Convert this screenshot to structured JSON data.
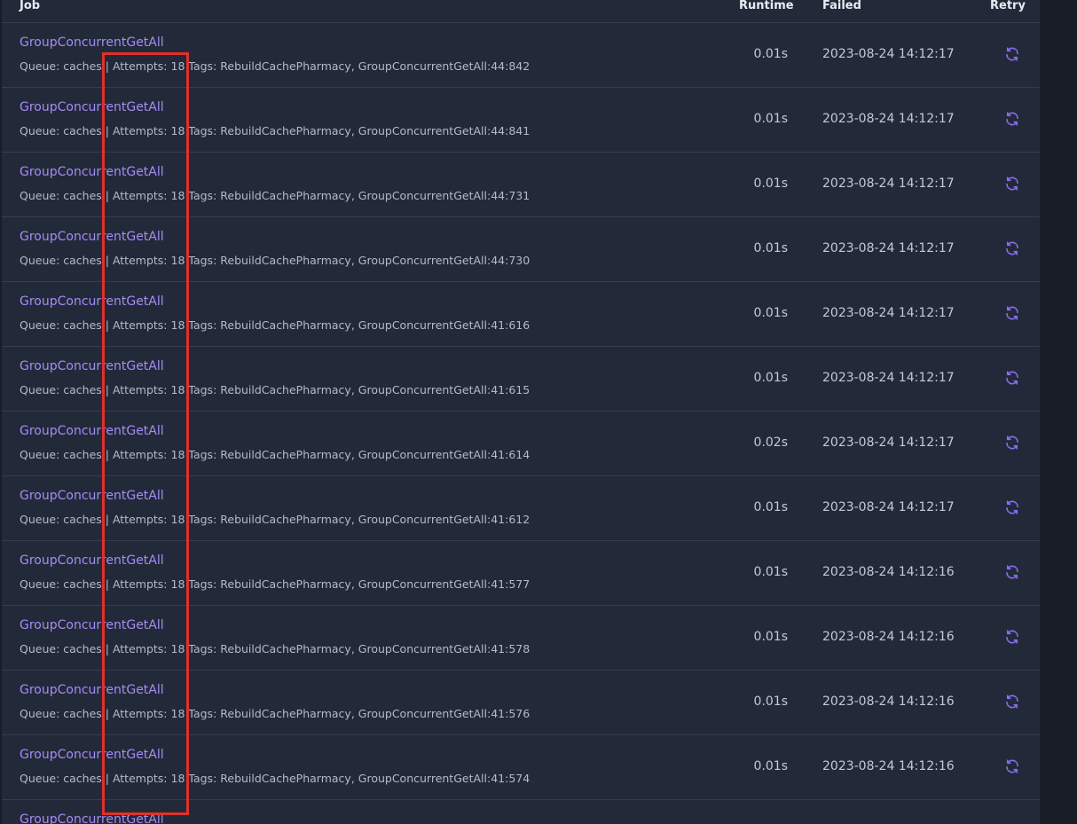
{
  "header": {
    "job": "Job",
    "runtime": "Runtime",
    "failed": "Failed",
    "retry": "Retry"
  },
  "jobs": [
    {
      "name": "GroupConcurrentGetAll",
      "queue": "Queue: caches",
      "attempts": "Attempts: 18",
      "tags": "Tags: RebuildCachePharmacy, GroupConcurrentGetAll:44:842",
      "runtime": "0.01s",
      "failed": "2023-08-24 14:12:17"
    },
    {
      "name": "GroupConcurrentGetAll",
      "queue": "Queue: caches",
      "attempts": "Attempts: 18",
      "tags": "Tags: RebuildCachePharmacy, GroupConcurrentGetAll:44:841",
      "runtime": "0.01s",
      "failed": "2023-08-24 14:12:17"
    },
    {
      "name": "GroupConcurrentGetAll",
      "queue": "Queue: caches",
      "attempts": "Attempts: 18",
      "tags": "Tags: RebuildCachePharmacy, GroupConcurrentGetAll:44:731",
      "runtime": "0.01s",
      "failed": "2023-08-24 14:12:17"
    },
    {
      "name": "GroupConcurrentGetAll",
      "queue": "Queue: caches",
      "attempts": "Attempts: 18",
      "tags": "Tags: RebuildCachePharmacy, GroupConcurrentGetAll:44:730",
      "runtime": "0.01s",
      "failed": "2023-08-24 14:12:17"
    },
    {
      "name": "GroupConcurrentGetAll",
      "queue": "Queue: caches",
      "attempts": "Attempts: 18",
      "tags": "Tags: RebuildCachePharmacy, GroupConcurrentGetAll:41:616",
      "runtime": "0.01s",
      "failed": "2023-08-24 14:12:17"
    },
    {
      "name": "GroupConcurrentGetAll",
      "queue": "Queue: caches",
      "attempts": "Attempts: 18",
      "tags": "Tags: RebuildCachePharmacy, GroupConcurrentGetAll:41:615",
      "runtime": "0.01s",
      "failed": "2023-08-24 14:12:17"
    },
    {
      "name": "GroupConcurrentGetAll",
      "queue": "Queue: caches",
      "attempts": "Attempts: 18",
      "tags": "Tags: RebuildCachePharmacy, GroupConcurrentGetAll:41:614",
      "runtime": "0.02s",
      "failed": "2023-08-24 14:12:17"
    },
    {
      "name": "GroupConcurrentGetAll",
      "queue": "Queue: caches",
      "attempts": "Attempts: 18",
      "tags": "Tags: RebuildCachePharmacy, GroupConcurrentGetAll:41:612",
      "runtime": "0.01s",
      "failed": "2023-08-24 14:12:17"
    },
    {
      "name": "GroupConcurrentGetAll",
      "queue": "Queue: caches",
      "attempts": "Attempts: 18",
      "tags": "Tags: RebuildCachePharmacy, GroupConcurrentGetAll:41:577",
      "runtime": "0.01s",
      "failed": "2023-08-24 14:12:16"
    },
    {
      "name": "GroupConcurrentGetAll",
      "queue": "Queue: caches",
      "attempts": "Attempts: 18",
      "tags": "Tags: RebuildCachePharmacy, GroupConcurrentGetAll:41:578",
      "runtime": "0.01s",
      "failed": "2023-08-24 14:12:16"
    },
    {
      "name": "GroupConcurrentGetAll",
      "queue": "Queue: caches",
      "attempts": "Attempts: 18",
      "tags": "Tags: RebuildCachePharmacy, GroupConcurrentGetAll:41:576",
      "runtime": "0.01s",
      "failed": "2023-08-24 14:12:16"
    },
    {
      "name": "GroupConcurrentGetAll",
      "queue": "Queue: caches",
      "attempts": "Attempts: 18",
      "tags": "Tags: RebuildCachePharmacy, GroupConcurrentGetAll:41:574",
      "runtime": "0.01s",
      "failed": "2023-08-24 14:12:16"
    },
    {
      "name": "GroupConcurrentGetAll",
      "queue": "",
      "attempts": "",
      "tags": "",
      "runtime": "",
      "failed": ""
    }
  ],
  "colors": {
    "link": "#a68bf5",
    "highlight": "#e2302b",
    "retry_icon": "#8b6cf0"
  },
  "icons": {
    "retry": "refresh-icon"
  }
}
